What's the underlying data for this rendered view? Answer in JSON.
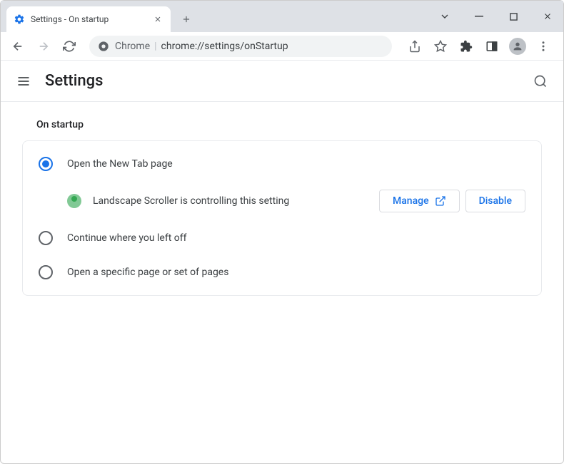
{
  "tab": {
    "title": "Settings - On startup"
  },
  "omnibox": {
    "prefix": "Chrome",
    "url": "chrome://settings/onStartup"
  },
  "header": {
    "title": "Settings"
  },
  "section": {
    "title": "On startup",
    "options": [
      {
        "label": "Open the New Tab page",
        "checked": true
      },
      {
        "label": "Continue where you left off",
        "checked": false
      },
      {
        "label": "Open a specific page or set of pages",
        "checked": false
      }
    ],
    "extension": {
      "message": "Landscape Scroller is controlling this setting",
      "manage_label": "Manage",
      "disable_label": "Disable"
    }
  }
}
